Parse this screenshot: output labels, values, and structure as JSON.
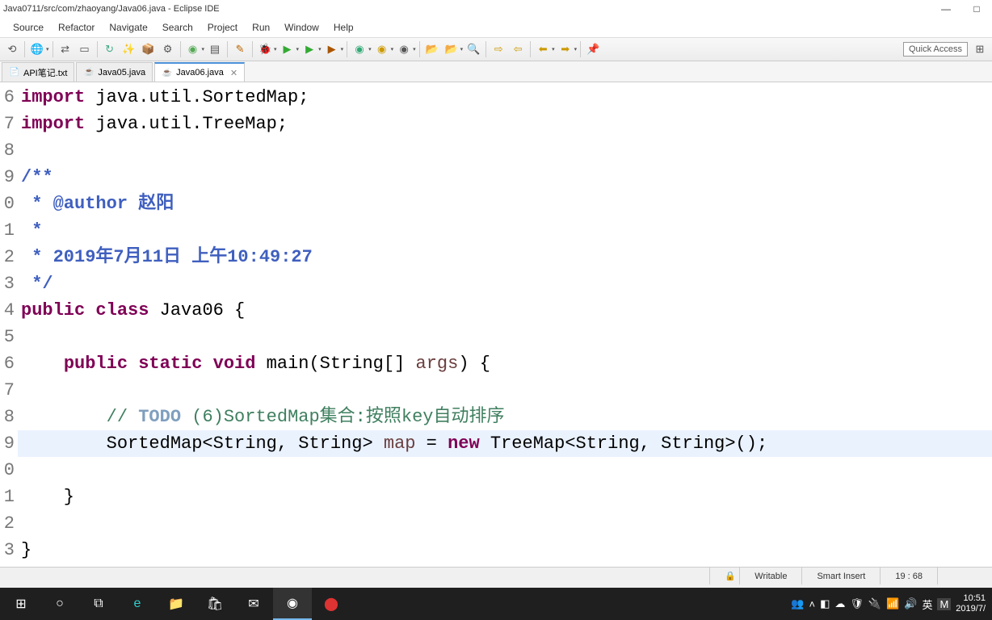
{
  "titlebar": {
    "title": "Java0711/src/com/zhaoyang/Java06.java - Eclipse IDE"
  },
  "menu": [
    "Source",
    "Refactor",
    "Navigate",
    "Search",
    "Project",
    "Run",
    "Window",
    "Help"
  ],
  "quickAccess": "Quick Access",
  "tabs": [
    {
      "label": "API笔记.txt",
      "active": false
    },
    {
      "label": "Java05.java",
      "active": false
    },
    {
      "label": "Java06.java",
      "active": true
    }
  ],
  "code": {
    "startLine": 6,
    "lines": [
      {
        "n": 6,
        "segs": [
          {
            "t": "import ",
            "c": "kw"
          },
          {
            "t": "java.util.SortedMap;",
            "c": "nm"
          }
        ]
      },
      {
        "n": 7,
        "segs": [
          {
            "t": "import ",
            "c": "kw"
          },
          {
            "t": "java.util.TreeMap;",
            "c": "nm"
          }
        ]
      },
      {
        "n": 8,
        "segs": []
      },
      {
        "n": 9,
        "segs": [
          {
            "t": "/**",
            "c": "cmtag"
          }
        ]
      },
      {
        "n": 0,
        "segs": [
          {
            "t": " * ",
            "c": "cmtag"
          },
          {
            "t": "@author",
            "c": "cmtag"
          },
          {
            "t": " 赵阳",
            "c": "cmtag"
          }
        ]
      },
      {
        "n": 1,
        "segs": [
          {
            "t": " *",
            "c": "cmtag"
          }
        ]
      },
      {
        "n": 2,
        "segs": [
          {
            "t": " * 2019年7月11日 上午10:49:27",
            "c": "cmtag"
          }
        ]
      },
      {
        "n": 3,
        "segs": [
          {
            "t": " */",
            "c": "cmtag"
          }
        ]
      },
      {
        "n": 4,
        "segs": [
          {
            "t": "public class ",
            "c": "kw"
          },
          {
            "t": "Java06 {",
            "c": "nm"
          }
        ]
      },
      {
        "n": 5,
        "segs": []
      },
      {
        "n": 6,
        "segs": [
          {
            "t": "    ",
            "c": "nm"
          },
          {
            "t": "public static void ",
            "c": "kw"
          },
          {
            "t": "main(String[] ",
            "c": "nm"
          },
          {
            "t": "args",
            "c": "id"
          },
          {
            "t": ") {",
            "c": "nm"
          }
        ]
      },
      {
        "n": 7,
        "segs": []
      },
      {
        "n": 8,
        "segs": [
          {
            "t": "        ",
            "c": "nm"
          },
          {
            "t": "// ",
            "c": "cm"
          },
          {
            "t": "TODO",
            "c": "todo"
          },
          {
            "t": " (6)SortedMap集合:按照key自动排序",
            "c": "cm"
          }
        ]
      },
      {
        "n": 9,
        "hl": true,
        "segs": [
          {
            "t": "        SortedMap<String, String> ",
            "c": "nm"
          },
          {
            "t": "map",
            "c": "id"
          },
          {
            "t": " = ",
            "c": "nm"
          },
          {
            "t": "new ",
            "c": "kw"
          },
          {
            "t": "TreeMap<String, String>();",
            "c": "nm"
          }
        ]
      },
      {
        "n": 0,
        "segs": []
      },
      {
        "n": 1,
        "segs": [
          {
            "t": "    }",
            "c": "nm"
          }
        ]
      },
      {
        "n": 2,
        "segs": []
      },
      {
        "n": 3,
        "segs": [
          {
            "t": "}",
            "c": "nm"
          }
        ]
      }
    ]
  },
  "statusbar": {
    "writable": "Writable",
    "insert": "Smart Insert",
    "pos": "19 : 68"
  },
  "taskbar": {
    "clock_time": "10:51",
    "clock_date": "2019/7/",
    "ime": "英",
    "m": "M"
  }
}
